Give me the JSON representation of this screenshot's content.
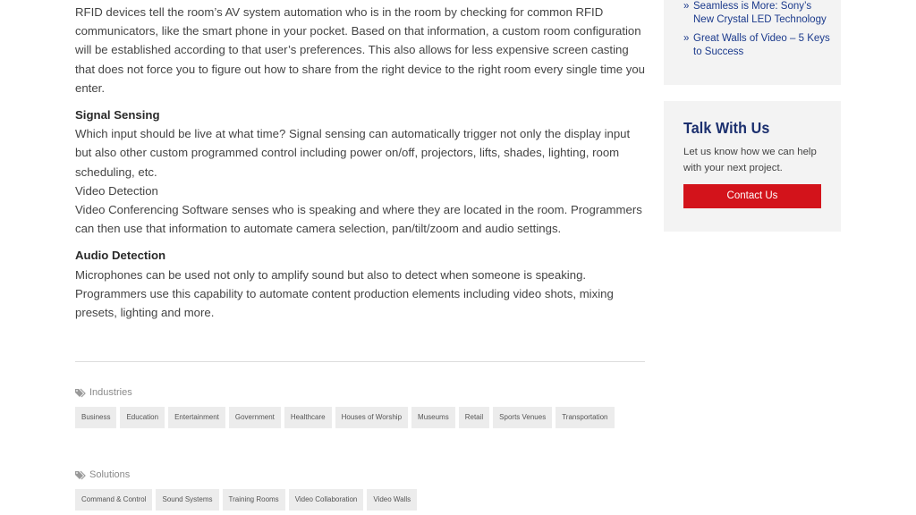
{
  "article": {
    "intro": "RFID devices tell the room’s AV system automation who is in the room by checking for common RFID communicators, like the smart phone in your pocket. Based on that information, a custom room configuration will be established according to that user’s preferences. This also allows for less expensive screen casting that does not force you to figure out how to share from the right device to the right room every single time you enter.",
    "signal_heading": "Signal Sensing",
    "signal_text": "Which input should be live at what time? Signal sensing can automatically trigger not only the display input but also other custom programmed control including power on/off, projectors, lifts, shades, lighting, room scheduling, etc.",
    "video_heading": "Video Detection",
    "video_text": "Video Conferencing Software senses who is speaking and where they are located in the room. Programmers can then use that information to automate camera selection, pan/tilt/zoom and audio settings.",
    "audio_heading": "Audio Detection",
    "audio_text": "Microphones can be used not only to amplify sound but also to detect when someone is speaking. Programmers use this capability to automate content production elements including video shots, mixing presets, lighting and more."
  },
  "taxonomy": {
    "industries_label": "Industries",
    "industries": [
      "Business",
      "Education",
      "Entertainment",
      "Government",
      "Healthcare",
      "Houses of Worship",
      "Museums",
      "Retail",
      "Sports Venues",
      "Transportation"
    ],
    "solutions_label": "Solutions",
    "solutions": [
      "Command & Control",
      "Sound Systems",
      "Training Rooms",
      "Video Collaboration",
      "Video Walls"
    ]
  },
  "sidebar": {
    "recent_posts": [
      {
        "bullet": "»",
        "title": "Seamless is More: Sony’s New Crystal LED Technology"
      },
      {
        "bullet": "»",
        "title": "Great Walls of Video – 5 Keys to Success"
      }
    ],
    "talk": {
      "title": "Talk With Us",
      "text": "Let us know how we can help with your next project.",
      "button_label": "Contact Us"
    }
  },
  "colors": {
    "link": "#1b3a8c",
    "heading_blue": "#1b2f6e",
    "button_red": "#d3131b",
    "tag_bg": "#ececec",
    "sidebar_bg": "#f3f3f3"
  },
  "icons": {
    "taxonomy_icon": "tags-icon"
  }
}
